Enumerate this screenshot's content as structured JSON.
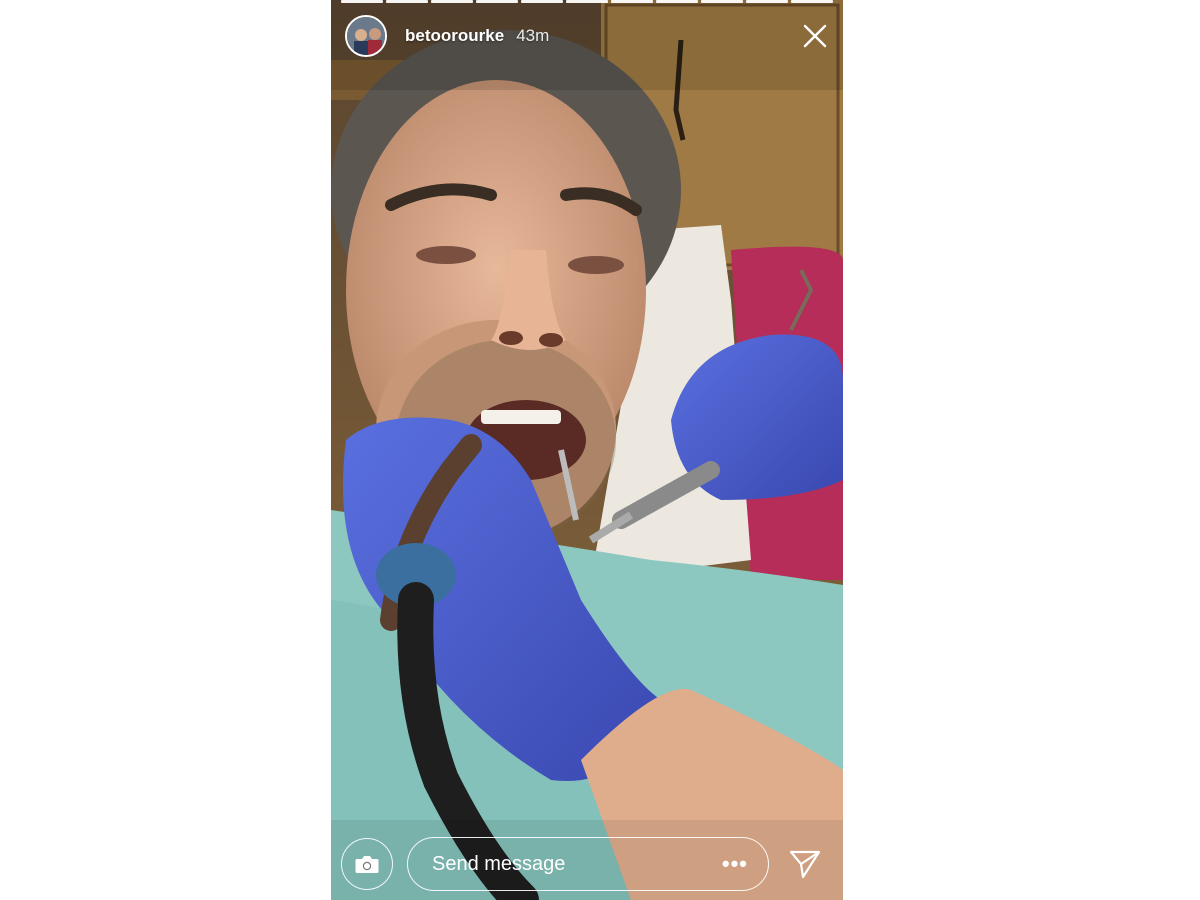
{
  "story": {
    "username": "betoorourke",
    "timestamp": "43m",
    "progress_segments": 11,
    "progress_completed": 11,
    "message_placeholder": "Send message",
    "more_label": "•••"
  },
  "icons": {
    "close": "close-icon",
    "camera": "camera-icon",
    "share": "send-icon",
    "avatar": "profile-avatar"
  },
  "colors": {
    "glove": "#4a5fd0",
    "bib": "#8cc8c0",
    "cabinet": "#8a6a3c",
    "chair": "#c0365e"
  }
}
